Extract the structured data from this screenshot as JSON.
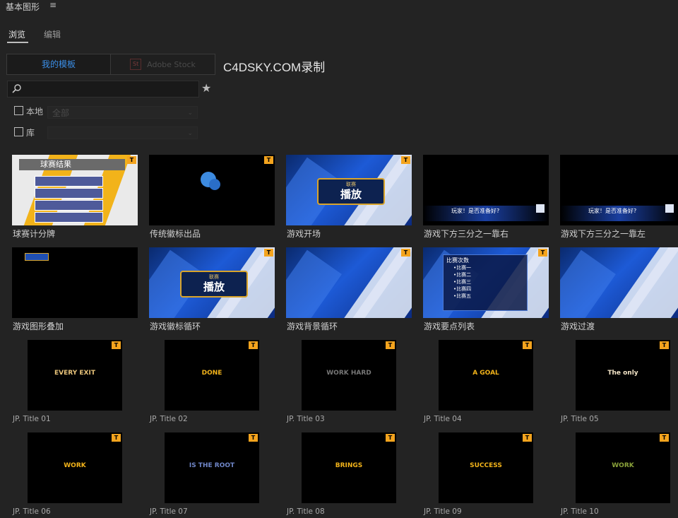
{
  "panel": {
    "title": "基本图形",
    "menu_icon": "hamburger-icon"
  },
  "tabs": [
    {
      "label": "浏览"
    },
    {
      "label": "编辑"
    }
  ],
  "source_toggle": {
    "my_templates": "我的模板",
    "adobe_stock": "Adobe Stock",
    "stock_icon_text": "St"
  },
  "watermark": "C4DSKY.COM录制",
  "filters": {
    "local": {
      "label": "本地",
      "value": "全部"
    },
    "library": {
      "label": "库",
      "value": ""
    }
  },
  "colors": {
    "accent": "#3b8fe8",
    "badge": "#f4a41e"
  },
  "templates": [
    {
      "label": "球赛计分牌",
      "thumb": "scoreboard"
    },
    {
      "label": "传统徽标出品",
      "thumb": "logo"
    },
    {
      "label": "游戏开场",
      "thumb": "play"
    },
    {
      "label": "游戏下方三分之一靠右",
      "thumb": "lowerthird"
    },
    {
      "label": "游戏下方三分之一靠左",
      "thumb": "lowerthird"
    },
    {
      "label": "游戏图形叠加",
      "thumb": "overlay"
    },
    {
      "label": "游戏徽标循环",
      "thumb": "play"
    },
    {
      "label": "游戏背景循环",
      "thumb": "bg"
    },
    {
      "label": "游戏要点列表",
      "thumb": "list"
    },
    {
      "label": "游戏过渡",
      "thumb": "bg"
    },
    {
      "label": "JP. Title 01",
      "thumb": "jp"
    },
    {
      "label": "JP. Title 02",
      "thumb": "jp"
    },
    {
      "label": "JP. Title 03",
      "thumb": "jp"
    },
    {
      "label": "JP. Title 04",
      "thumb": "jp"
    },
    {
      "label": "JP. Title 05",
      "thumb": "jp"
    },
    {
      "label": "JP. Title 06",
      "thumb": "jp"
    },
    {
      "label": "JP. Title 07",
      "thumb": "jp"
    },
    {
      "label": "JP. Title 08",
      "thumb": "jp"
    },
    {
      "label": "JP. Title 09",
      "thumb": "jp"
    },
    {
      "label": "JP. Title 10",
      "thumb": "jp"
    }
  ],
  "thumb_text": {
    "scoreboard_title": "球赛结果",
    "play_word": "播放",
    "play_small": "联赛",
    "list_title": "比赛次数",
    "list_items": [
      "•比赛一",
      "•比赛二",
      "•比赛三",
      "•比赛四",
      "•比赛五"
    ],
    "lower_text": "玩家！是否准备好?",
    "jp_words": [
      "EVERY EXIT",
      "DONE",
      "WORK HARD",
      "A GOAL",
      "The only",
      "WORK",
      "IS THE ROOT",
      "BRINGS",
      "SUCCESS",
      "WORK"
    ]
  }
}
